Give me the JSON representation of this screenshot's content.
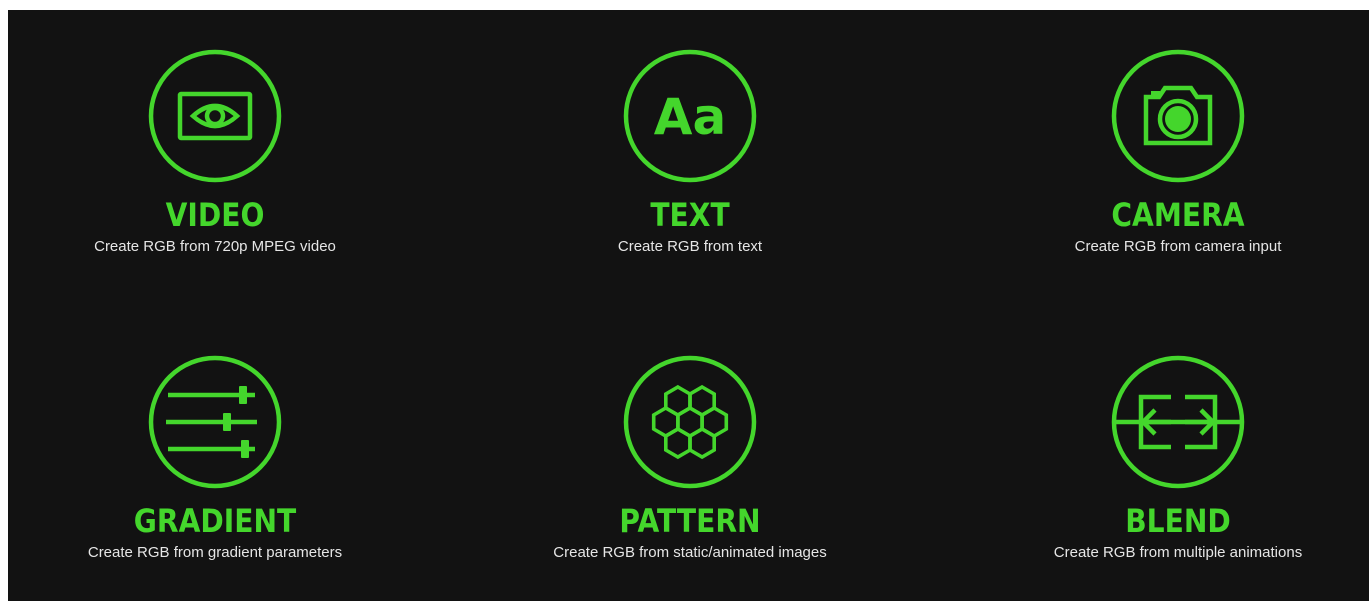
{
  "features": [
    {
      "key": "video",
      "title": "VIDEO",
      "description": "Create RGB from 720p MPEG video",
      "icon": "video-eye-icon"
    },
    {
      "key": "text",
      "title": "TEXT",
      "description": "Create RGB from text",
      "icon": "text-aa-icon",
      "icon_text": "Aa"
    },
    {
      "key": "camera",
      "title": "CAMERA",
      "description": "Create RGB from camera input",
      "icon": "camera-icon"
    },
    {
      "key": "gradient",
      "title": "GRADIENT",
      "description": "Create RGB from gradient parameters",
      "icon": "sliders-icon"
    },
    {
      "key": "pattern",
      "title": "PATTERN",
      "description": "Create RGB from static/animated images",
      "icon": "hexagon-pattern-icon"
    },
    {
      "key": "blend",
      "title": "BLEND",
      "description": "Create RGB from multiple animations",
      "icon": "blend-arrows-icon"
    }
  ],
  "colors": {
    "accent": "#44d62c",
    "background": "#121212",
    "text": "#e6e6e6"
  }
}
